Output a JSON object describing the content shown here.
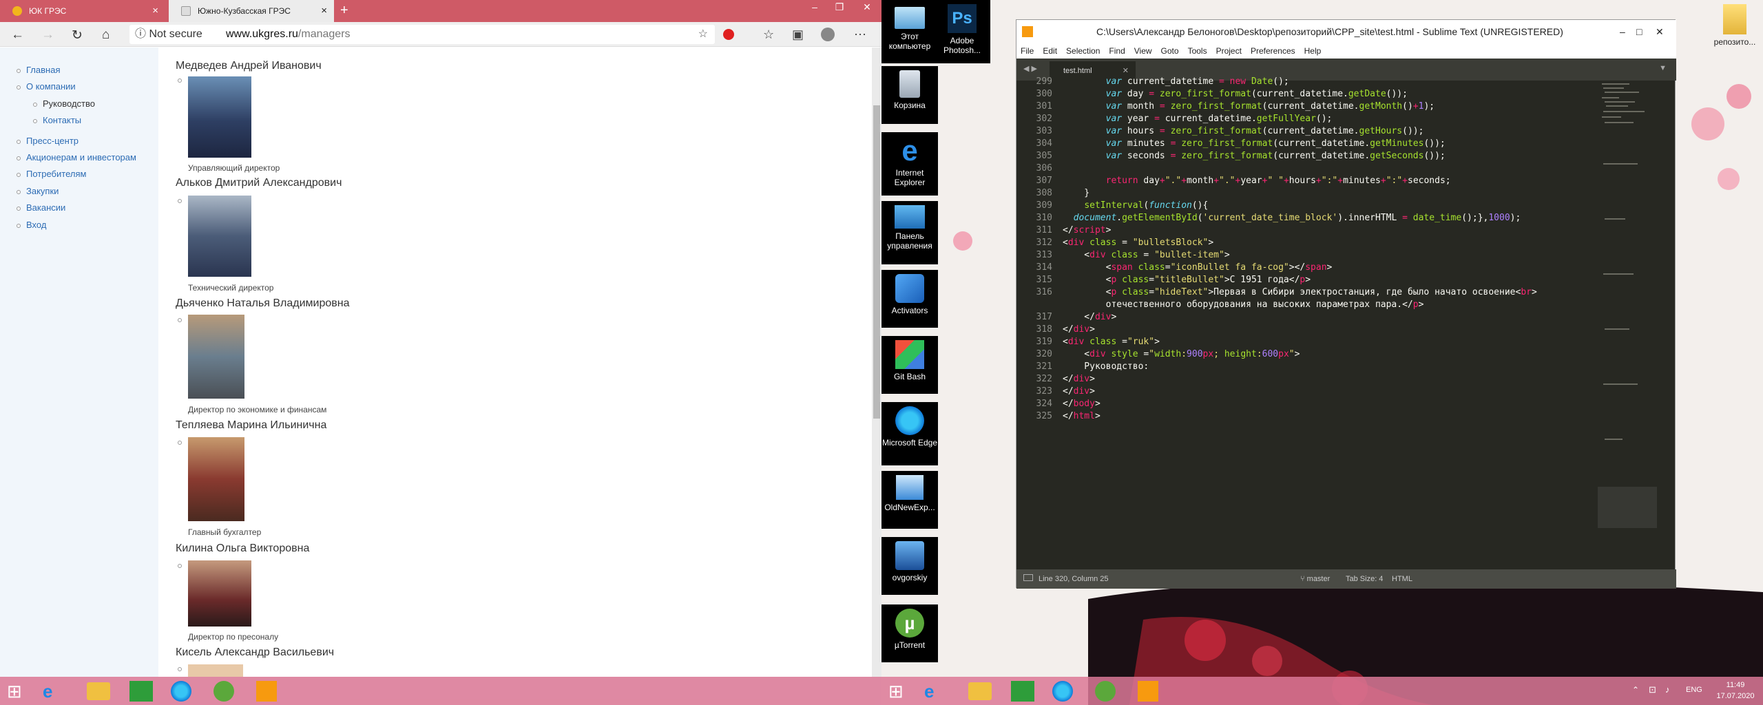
{
  "browser": {
    "tabs": [
      {
        "title": "ЮК ГРЭС",
        "active": false
      },
      {
        "title": "Южно-Кузбасская ГРЭС",
        "active": true
      }
    ],
    "security": "Not secure",
    "url_domain": "www.ukgres.ru",
    "url_path": "/managers",
    "sidebar": [
      {
        "label": "Главная",
        "level": 1
      },
      {
        "label": "О компании",
        "level": 1
      },
      {
        "label": "Руководство",
        "level": 2
      },
      {
        "label": "Контакты",
        "level": 2
      },
      {
        "label": "Пресс-центр",
        "level": 1
      },
      {
        "label": "Акционерам и инвесторам",
        "level": 1
      },
      {
        "label": "Потребителям",
        "level": 1
      },
      {
        "label": "Закупки",
        "level": 1
      },
      {
        "label": "Вакансии",
        "level": 1
      },
      {
        "label": "Вход",
        "level": 1
      }
    ],
    "managers": [
      {
        "name": "Медведев Андрей Иванович",
        "position": "Управляющий директор"
      },
      {
        "name": "Альков Дмитрий Александрович",
        "position": "Технический директор"
      },
      {
        "name": "Дьяченко Наталья Владимировна",
        "position": "Директор по экономике и финансам"
      },
      {
        "name": "Тепляева Марина Ильинична",
        "position": "Главный бухгалтер"
      },
      {
        "name": "Килина Ольга Викторовна",
        "position": "Директор по пресоналу"
      },
      {
        "name": "Кисель Александр Васильевич",
        "position": ""
      }
    ]
  },
  "desktop_icons": [
    {
      "label": "Этот компьютер",
      "icon": "computer-icon"
    },
    {
      "label": "Adobe Photosh...",
      "icon": "photoshop-icon"
    },
    {
      "label": "Корзина",
      "icon": "recycle-bin-icon"
    },
    {
      "label": "Internet Explorer",
      "icon": "ie-icon"
    },
    {
      "label": "Панель управления",
      "icon": "control-panel-icon"
    },
    {
      "label": "Activators",
      "icon": "activators-icon"
    },
    {
      "label": "Git Bash",
      "icon": "git-bash-icon"
    },
    {
      "label": "Microsoft Edge",
      "icon": "edge-icon"
    },
    {
      "label": "OldNewExp...",
      "icon": "oldnewexplorer-icon"
    },
    {
      "label": "ovgorskiy",
      "icon": "folder-user-icon"
    },
    {
      "label": "µTorrent",
      "icon": "utorrent-icon"
    },
    {
      "label": "репозито...",
      "icon": "folder-icon"
    }
  ],
  "sublime": {
    "title": "C:\\Users\\Александр Белоногов\\Desktop\\репозиторий\\CPP_site\\test.html - Sublime Text (UNREGISTERED)",
    "menu": [
      "File",
      "Edit",
      "Selection",
      "Find",
      "View",
      "Goto",
      "Tools",
      "Project",
      "Preferences",
      "Help"
    ],
    "tab": "test.html",
    "status_left": "Line 320, Column 25",
    "status_branch": "master",
    "status_tab": "Tab Size: 4",
    "status_syntax": "HTML",
    "lines": [
      {
        "n": "299",
        "html": "        <span class='kw'>var</span> current_datetime <span class='op'>=</span> <span class='op'>new</span> <span class='fn'>Date</span>();"
      },
      {
        "n": "300",
        "html": "        <span class='kw'>var</span> day <span class='op'>=</span> <span class='fn'>zero_first_format</span>(current_datetime.<span class='fn'>getDate</span>());"
      },
      {
        "n": "301",
        "html": "        <span class='kw'>var</span> month <span class='op'>=</span> <span class='fn'>zero_first_format</span>(current_datetime.<span class='fn'>getMonth</span>()<span class='op'>+</span><span class='num'>1</span>);"
      },
      {
        "n": "302",
        "html": "        <span class='kw'>var</span> year <span class='op'>=</span> current_datetime.<span class='fn'>getFullYear</span>();"
      },
      {
        "n": "303",
        "html": "        <span class='kw'>var</span> hours <span class='op'>=</span> <span class='fn'>zero_first_format</span>(current_datetime.<span class='fn'>getHours</span>());"
      },
      {
        "n": "304",
        "html": "        <span class='kw'>var</span> minutes <span class='op'>=</span> <span class='fn'>zero_first_format</span>(current_datetime.<span class='fn'>getMinutes</span>());"
      },
      {
        "n": "305",
        "html": "        <span class='kw'>var</span> seconds <span class='op'>=</span> <span class='fn'>zero_first_format</span>(current_datetime.<span class='fn'>getSeconds</span>());"
      },
      {
        "n": "306",
        "html": ""
      },
      {
        "n": "307",
        "html": "        <span class='op'>return</span> day<span class='op'>+</span><span class='str'>\".\"</span><span class='op'>+</span>month<span class='op'>+</span><span class='str'>\".\"</span><span class='op'>+</span>year<span class='op'>+</span><span class='str'>\" \"</span><span class='op'>+</span>hours<span class='op'>+</span><span class='str'>\":\"</span><span class='op'>+</span>minutes<span class='op'>+</span><span class='str'>\":\"</span><span class='op'>+</span>seconds;"
      },
      {
        "n": "308",
        "html": "    }"
      },
      {
        "n": "309",
        "html": "    <span class='fn'>setInterval</span>(<span class='kw'>function</span>(){"
      },
      {
        "n": "310",
        "html": "  <span class='kw'>document</span>.<span class='fn'>getElementById</span>(<span class='str'>'current_date_time_block'</span>).innerHTML <span class='op'>=</span> <span class='fn'>date_time</span>();},<span class='num'>1000</span>);"
      },
      {
        "n": "311",
        "html": "&lt;/<span class='tag'>script</span>&gt;"
      },
      {
        "n": "312",
        "html": "&lt;<span class='tag'>div</span> <span class='attr'>class</span> = <span class='str'>\"bulletsBlock\"</span>&gt;"
      },
      {
        "n": "313",
        "html": "    &lt;<span class='tag'>div</span> <span class='attr'>class</span> = <span class='str'>\"bullet-item\"</span>&gt;"
      },
      {
        "n": "314",
        "html": "        &lt;<span class='tag'>span</span> <span class='attr'>class</span>=<span class='str'>\"iconBullet fa fa-cog\"</span>&gt;&lt;/<span class='tag'>span</span>&gt;"
      },
      {
        "n": "315",
        "html": "        &lt;<span class='tag'>p</span> <span class='attr'>class</span>=<span class='str'>\"titleBullet\"</span>&gt;С 1951 года&lt;/<span class='tag'>p</span>&gt;"
      },
      {
        "n": "316",
        "html": "        &lt;<span class='tag'>p</span> <span class='attr'>class</span>=<span class='str'>\"hideText\"</span>&gt;Первая в Сибири электростанция, где было начато освоение&lt;<span class='tag'>br</span>&gt;"
      },
      {
        "n": "",
        "html": "        отечественного оборудования на высоких параметрах пара.&lt;/<span class='tag'>p</span>&gt;"
      },
      {
        "n": "317",
        "html": "    &lt;/<span class='tag'>div</span>&gt;"
      },
      {
        "n": "318",
        "html": "&lt;/<span class='tag'>div</span>&gt;"
      },
      {
        "n": "319",
        "html": "&lt;<span class='tag'>div</span> <span class='attr'>class</span> =<span class='str'>\"ruk\"</span>&gt;"
      },
      {
        "n": "320",
        "html": "    &lt;<span class='tag'>div</span> <span class='attr'>style</span> =<span class='str'>\"<span class='attr'>width</span>:<span class='num'>900</span><span class='op'>px</span>; <span class='attr'>height</span>:<span class='num'>600</span><span class='op'>px</span>\"</span>&gt;"
      },
      {
        "n": "321",
        "html": "    Руководство:"
      },
      {
        "n": "322",
        "html": "&lt;/<span class='tag'>div</span>&gt;"
      },
      {
        "n": "323",
        "html": "&lt;/<span class='tag'>div</span>&gt;"
      },
      {
        "n": "324",
        "html": "&lt;/<span class='tag'>body</span>&gt;"
      },
      {
        "n": "325",
        "html": "&lt;/<span class='tag'>html</span>&gt;"
      }
    ]
  },
  "taskbar": {
    "lang": "ENG",
    "time": "11:49",
    "date": "17.07.2020"
  },
  "colors": {
    "taskbar": "#dc7896",
    "browser_tabbar": "#cf5a66",
    "link": "#2d6cb4",
    "sublime_bg": "#272822"
  }
}
